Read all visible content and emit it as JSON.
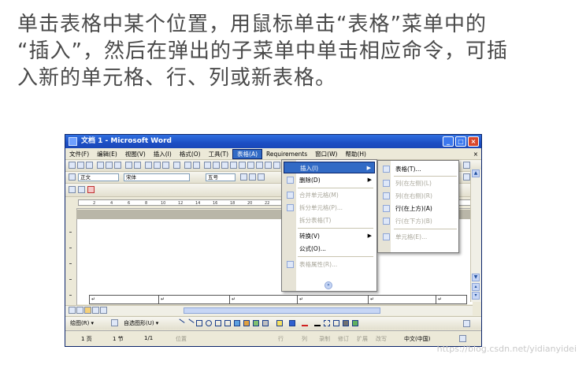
{
  "caption": {
    "line1": "单击表格中某个位置，用鼠标单击“表格”菜单中的",
    "line2": "“插入”，然后在弹出的子菜单中单击相应命令，可插",
    "line3": "入新的单元格、行、列或新表格。"
  },
  "window": {
    "title": "文档 1 - Microsoft Word",
    "controls": {
      "minimize": "_",
      "maximize": "□",
      "close": "×"
    }
  },
  "menubar": {
    "items": [
      {
        "label": "文件(F)"
      },
      {
        "label": "编辑(E)"
      },
      {
        "label": "视图(V)"
      },
      {
        "label": "插入(I)"
      },
      {
        "label": "格式(O)"
      },
      {
        "label": "工具(T)"
      },
      {
        "label": "表格(A)"
      },
      {
        "label": "Requirements"
      },
      {
        "label": "窗口(W)"
      },
      {
        "label": "帮助(H)"
      }
    ],
    "close_label": "×"
  },
  "formatting": {
    "style": "正文",
    "font": "宋体",
    "size": "五号"
  },
  "table_menu": {
    "items": [
      {
        "label": "插入(I)",
        "highlight": true,
        "submenu": true
      },
      {
        "label": "删除(D)",
        "submenu": true
      },
      {
        "label": "合并单元格(M)",
        "disabled": true
      },
      {
        "label": "拆分单元格(P)...",
        "disabled": true
      },
      {
        "label": "拆分表格(T)",
        "disabled": true
      },
      {
        "label": "转换(V)",
        "submenu": true
      },
      {
        "label": "公式(O)..."
      },
      {
        "label": "表格属性(R)...",
        "disabled": true
      }
    ],
    "more": "»"
  },
  "insert_submenu": {
    "items": [
      {
        "label": "表格(T)..."
      },
      {
        "label": "列(在左侧)(L)",
        "disabled": true
      },
      {
        "label": "列(在右侧)(R)",
        "disabled": true
      },
      {
        "label": "行(在上方)(A)"
      },
      {
        "label": "行(在下方)(B)",
        "disabled": true
      },
      {
        "label": "单元格(E)...",
        "disabled": true
      }
    ]
  },
  "drawing": {
    "draw_label": "绘图(R) ▾",
    "autoshapes_label": "自选图形(U) ▾"
  },
  "statusbar": {
    "page": "1 页",
    "section": "1 节",
    "pages": "1/1",
    "position": "位置",
    "row": "行",
    "col": "列",
    "rec": "录制",
    "trk": "修订",
    "ext": "扩展",
    "ovr": "改写",
    "language": "中文(中国)"
  },
  "watermark": "https://blog.csdn.net/yidianyidei"
}
